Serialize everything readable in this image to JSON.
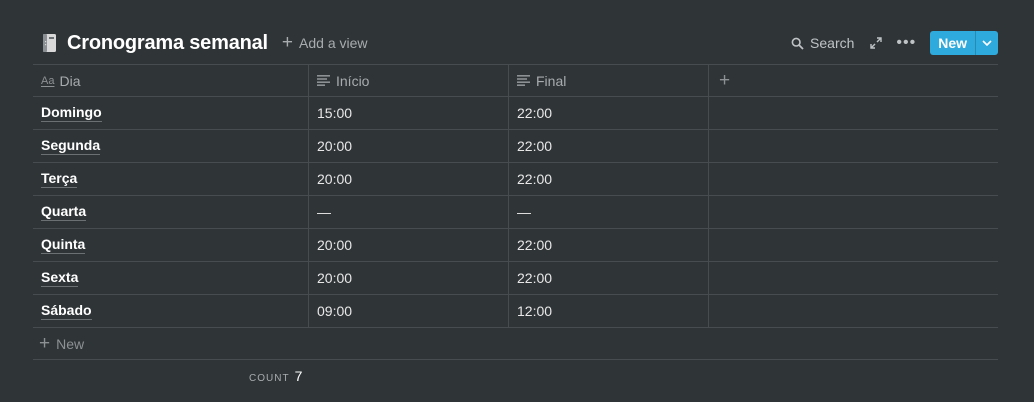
{
  "header": {
    "icon": "notebook-icon",
    "title": "Cronograma semanal",
    "add_view": "Add a view",
    "search": "Search",
    "new": "New"
  },
  "table": {
    "columns": [
      {
        "icon": "title-aa-icon",
        "icon_text": "Aa",
        "label": "Dia"
      },
      {
        "icon": "text-lines-icon",
        "label": "Início"
      },
      {
        "icon": "text-lines-icon",
        "label": "Final"
      }
    ],
    "rows": [
      {
        "dia": "Domingo",
        "inicio": "15:00",
        "final": "22:00"
      },
      {
        "dia": "Segunda",
        "inicio": "20:00",
        "final": "22:00"
      },
      {
        "dia": "Terça",
        "inicio": "20:00",
        "final": "22:00"
      },
      {
        "dia": "Quarta",
        "inicio": "—",
        "final": "—"
      },
      {
        "dia": "Quinta",
        "inicio": "20:00",
        "final": "22:00"
      },
      {
        "dia": "Sexta",
        "inicio": "20:00",
        "final": "22:00"
      },
      {
        "dia": "Sábado",
        "inicio": "09:00",
        "final": "12:00"
      }
    ],
    "new_row": "New"
  },
  "footer": {
    "count_label": "COUNT",
    "count_value": "7"
  },
  "colors": {
    "background": "#2f3437",
    "accent": "#2eaadc",
    "border": "#474c50"
  }
}
